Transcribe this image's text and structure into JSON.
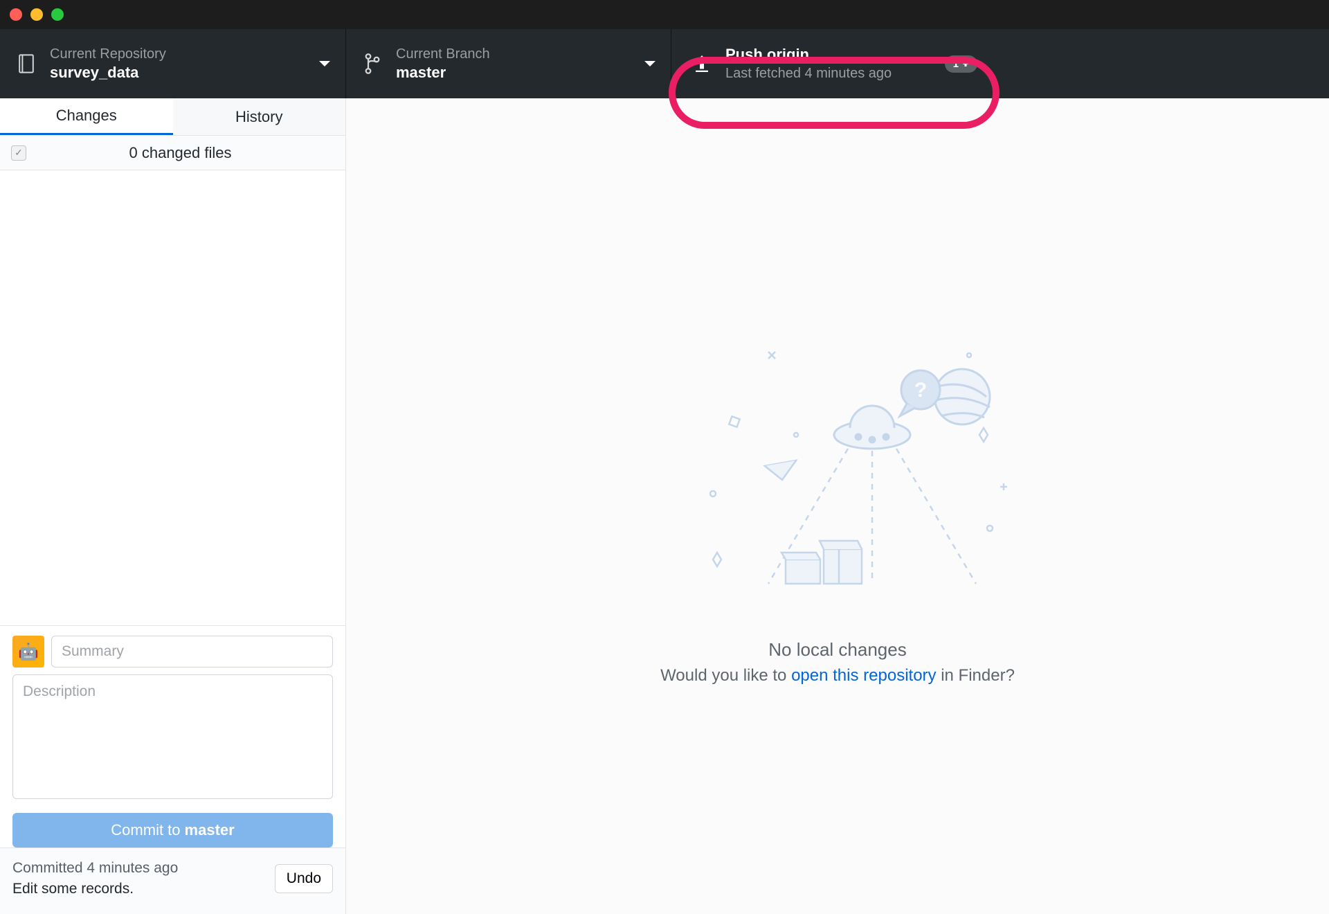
{
  "toolbar": {
    "repo": {
      "label": "Current Repository",
      "value": "survey_data"
    },
    "branch": {
      "label": "Current Branch",
      "value": "master"
    },
    "push": {
      "title": "Push origin",
      "subtitle": "Last fetched 4 minutes ago",
      "badge_count": "1"
    }
  },
  "sidebar": {
    "tabs": {
      "changes": "Changes",
      "history": "History"
    },
    "changes_header": "0 changed files",
    "commit": {
      "summary_placeholder": "Summary",
      "description_placeholder": "Description",
      "button_prefix": "Commit to ",
      "button_branch": "master"
    },
    "last_commit": {
      "time": "Committed 4 minutes ago",
      "message": "Edit some records.",
      "undo_label": "Undo"
    }
  },
  "main": {
    "empty_title": "No local changes",
    "empty_prefix": "Would you like to ",
    "empty_link": "open this repository",
    "empty_suffix": " in Finder?"
  }
}
